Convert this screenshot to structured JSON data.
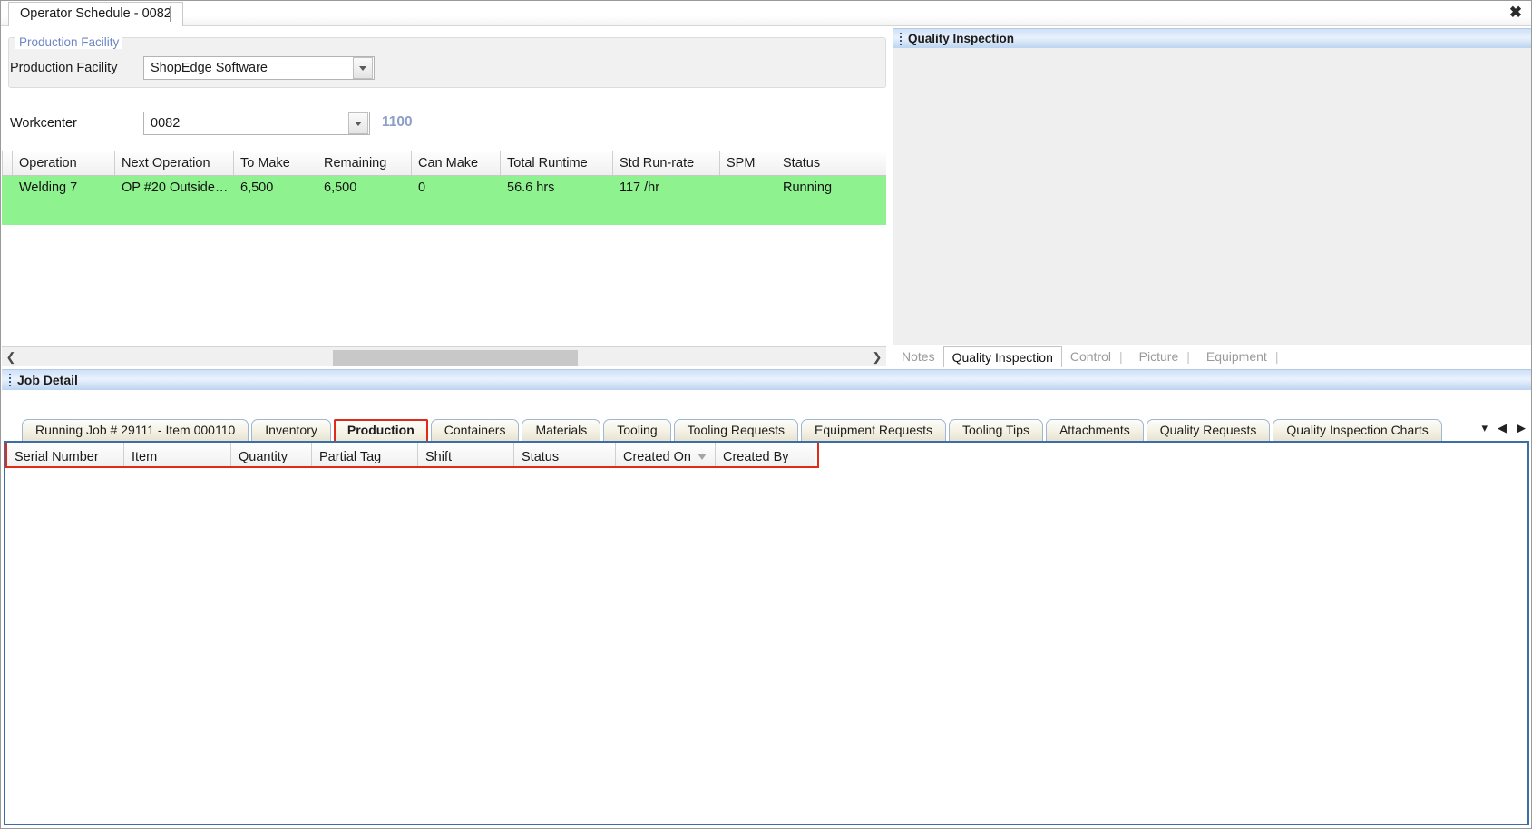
{
  "window": {
    "tab_label": "Operator Schedule - 0082",
    "close_icon": "close-icon"
  },
  "facility": {
    "group_legend": "Production Facility",
    "facility_label": "Production Facility",
    "facility_value": "ShopEdge Software",
    "workcenter_label": "Workcenter",
    "workcenter_value": "0082",
    "workcenter_code": "1100"
  },
  "schedule_grid": {
    "columns": [
      "Operation",
      "Next Operation",
      "To Make",
      "Remaining",
      "Can Make",
      "Total Runtime",
      "Std Run-rate",
      "SPM",
      "Status"
    ],
    "rows": [
      {
        "operation": "Welding 7",
        "next_operation": "OP  #20  Outside…",
        "to_make": "6,500",
        "remaining": "6,500",
        "can_make": "0",
        "total_runtime": "56.6 hrs",
        "std_run_rate": "117 /hr",
        "spm": "",
        "status": "Running"
      }
    ],
    "row_highlight_color": "#8ef28e"
  },
  "hscroll": {
    "left_arrow": "chevron-left-icon",
    "right_arrow": "chevron-right-icon"
  },
  "quality_inspection": {
    "title": "Quality Inspection",
    "tabs": [
      {
        "label": "Notes",
        "selected": false
      },
      {
        "label": "Quality Inspection",
        "selected": true
      },
      {
        "label": "Control",
        "selected": false
      },
      {
        "label": "Picture",
        "selected": false
      },
      {
        "label": "Equipment",
        "selected": false
      }
    ]
  },
  "job_detail": {
    "title": "Job Detail",
    "tabs": [
      {
        "label": "Running Job # 29111 - Item 000110",
        "active": false
      },
      {
        "label": "Inventory",
        "active": false
      },
      {
        "label": "Production",
        "active": true
      },
      {
        "label": "Containers",
        "active": false
      },
      {
        "label": "Materials",
        "active": false
      },
      {
        "label": "Tooling",
        "active": false
      },
      {
        "label": "Tooling Requests",
        "active": false
      },
      {
        "label": "Equipment Requests",
        "active": false
      },
      {
        "label": "Tooling Tips",
        "active": false
      },
      {
        "label": "Attachments",
        "active": false
      },
      {
        "label": "Quality Requests",
        "active": false
      },
      {
        "label": "Quality Inspection Charts",
        "active": false
      }
    ],
    "nav": {
      "menu_icon": "tab-list-icon",
      "prev_icon": "chevron-left-icon",
      "next_icon": "chevron-right-icon"
    }
  },
  "production_grid": {
    "columns": [
      {
        "label": "Serial Number",
        "sorted": false
      },
      {
        "label": "Item",
        "sorted": false
      },
      {
        "label": "Quantity",
        "sorted": false
      },
      {
        "label": "Partial Tag",
        "sorted": false
      },
      {
        "label": "Shift",
        "sorted": false
      },
      {
        "label": "Status",
        "sorted": false
      },
      {
        "label": "Created On",
        "sorted": true
      },
      {
        "label": "Created By",
        "sorted": false
      }
    ],
    "rows": []
  },
  "colors": {
    "accent_red": "#e02b18",
    "panel_blue": "#3b6ea5",
    "row_green": "#8ef28e",
    "link_blue": "#6d86c4"
  }
}
